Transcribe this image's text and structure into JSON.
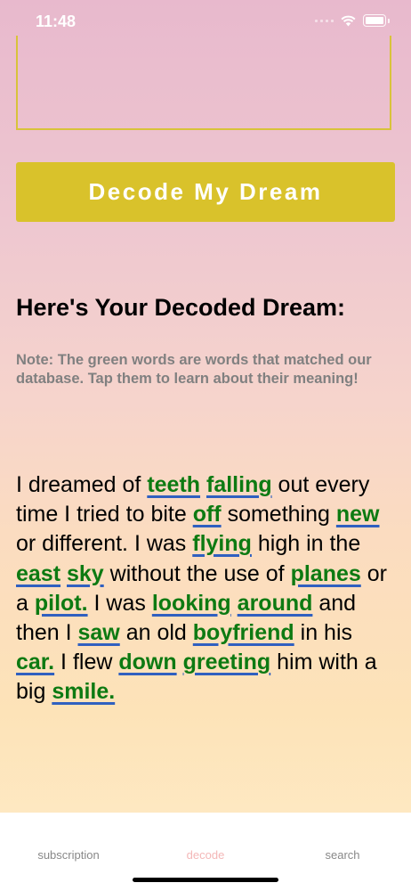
{
  "status_bar": {
    "time": "11:48"
  },
  "decode_button": {
    "label": "Decode My Dream"
  },
  "result": {
    "title": "Here's Your Decoded Dream:",
    "note": "Note: The green words are words that matched our database. Tap them to learn about their meaning!",
    "dream_segments": [
      {
        "text": "I dreamed of ",
        "match": false
      },
      {
        "text": "teeth",
        "match": true
      },
      {
        "text": " ",
        "match": false
      },
      {
        "text": "falling",
        "match": true
      },
      {
        "text": " out every time I tried to bite ",
        "match": false
      },
      {
        "text": "off",
        "match": true
      },
      {
        "text": " something ",
        "match": false
      },
      {
        "text": "new",
        "match": true
      },
      {
        "text": " or different. I was ",
        "match": false
      },
      {
        "text": "flying",
        "match": true
      },
      {
        "text": " high in the ",
        "match": false
      },
      {
        "text": "east",
        "match": true
      },
      {
        "text": " ",
        "match": false
      },
      {
        "text": "sky",
        "match": true
      },
      {
        "text": " without the use of ",
        "match": false
      },
      {
        "text": "planes",
        "match": true
      },
      {
        "text": " or a ",
        "match": false
      },
      {
        "text": "pilot.",
        "match": true
      },
      {
        "text": " I was ",
        "match": false
      },
      {
        "text": "looking",
        "match": true
      },
      {
        "text": " ",
        "match": false
      },
      {
        "text": "around",
        "match": true
      },
      {
        "text": " and then I ",
        "match": false
      },
      {
        "text": "saw",
        "match": true
      },
      {
        "text": " an old ",
        "match": false
      },
      {
        "text": "boyfriend",
        "match": true
      },
      {
        "text": " in his ",
        "match": false
      },
      {
        "text": "car.",
        "match": true
      },
      {
        "text": " I flew ",
        "match": false
      },
      {
        "text": "down",
        "match": true
      },
      {
        "text": " ",
        "match": false
      },
      {
        "text": "greeting",
        "match": true
      },
      {
        "text": " him with a big ",
        "match": false
      },
      {
        "text": "smile.",
        "match": true
      }
    ]
  },
  "tabs": [
    {
      "label": "subscription",
      "active": false
    },
    {
      "label": "decode",
      "active": true
    },
    {
      "label": "search",
      "active": false
    }
  ],
  "colors": {
    "button": "#d9c22b",
    "match_word": "#0d7a12",
    "underline": "#3060c0",
    "active_tab": "#f4b7b7"
  }
}
